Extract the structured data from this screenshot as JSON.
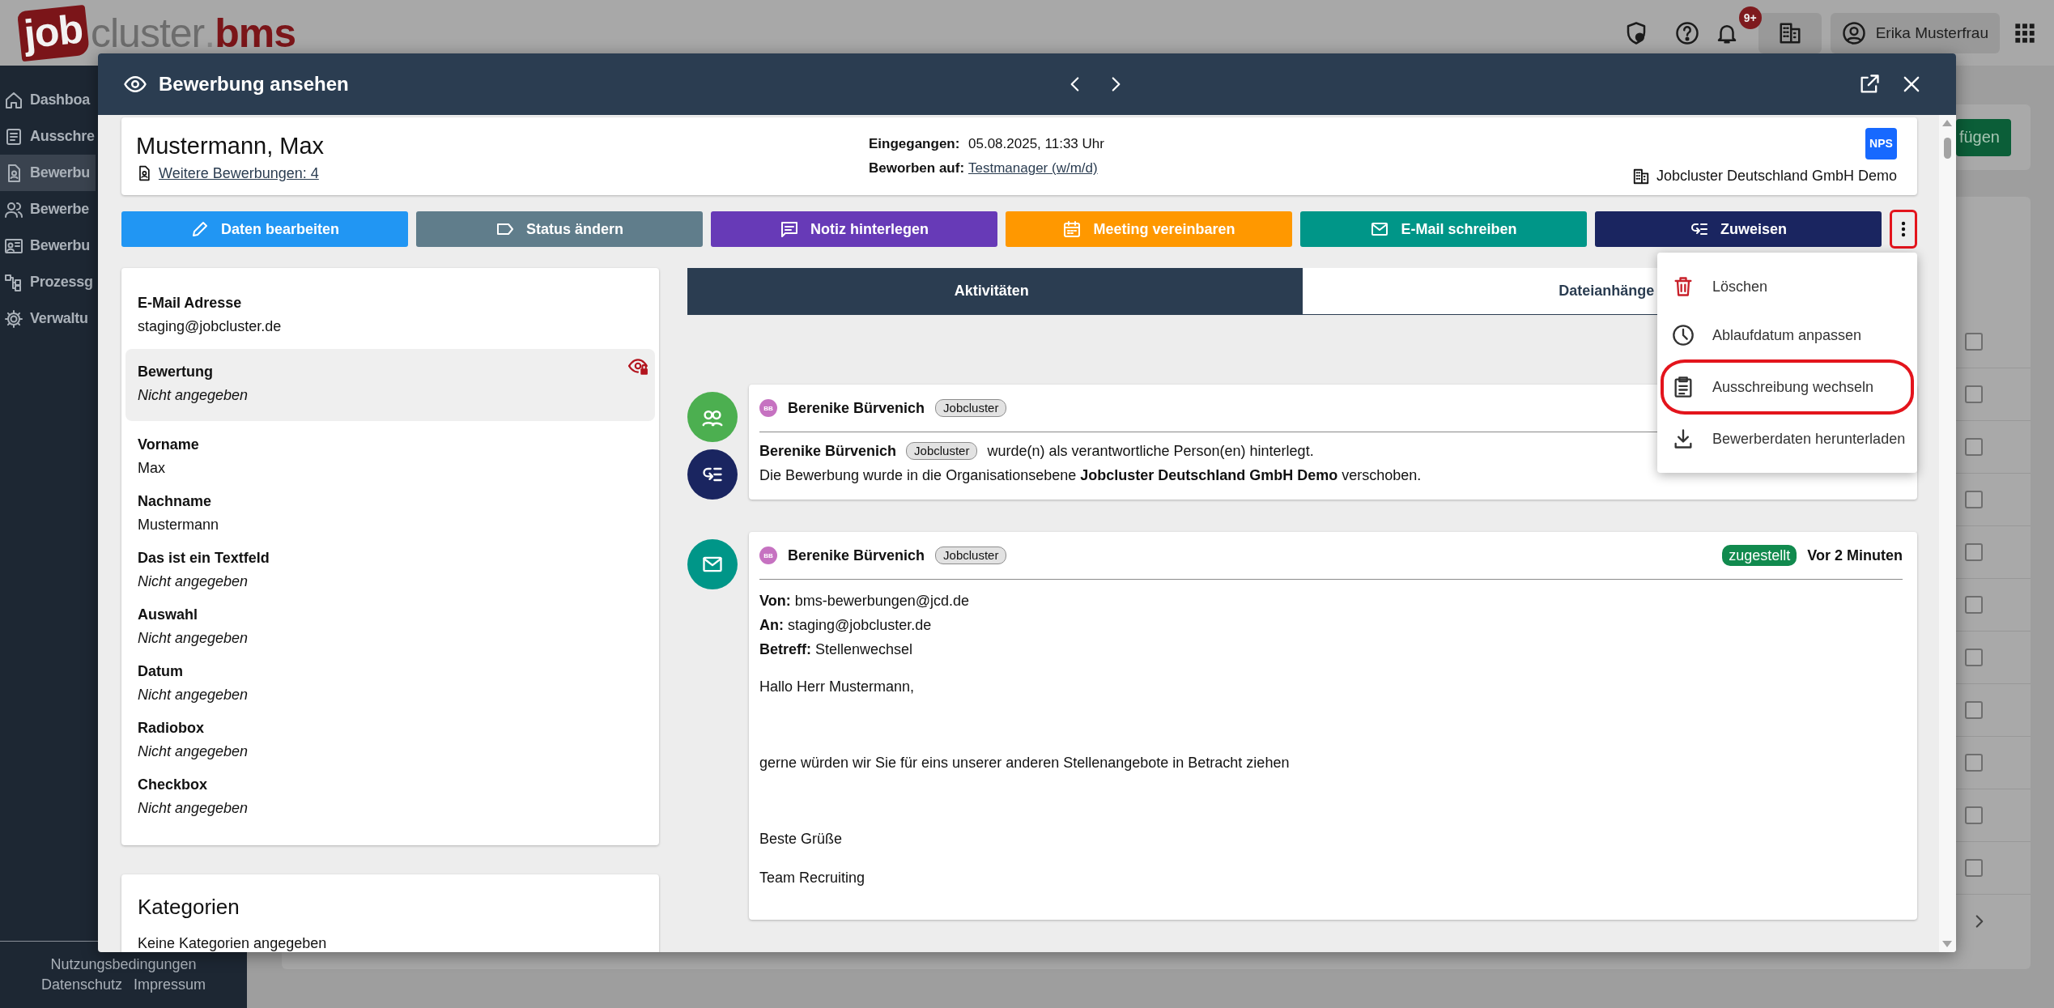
{
  "app": {
    "logo": [
      "job",
      "cluster",
      ".",
      "bms"
    ],
    "topbar": {
      "notifications": "9+",
      "user": "Erika Musterfrau"
    },
    "sidebar": {
      "items": [
        {
          "label": "Dashboa",
          "selected": false
        },
        {
          "label": "Ausschre",
          "selected": false
        },
        {
          "label": "Bewerbu",
          "selected": true
        },
        {
          "label": "Bewerbe",
          "selected": false
        },
        {
          "label": "Bewerbu",
          "selected": false
        },
        {
          "label": "Prozessg",
          "selected": false
        },
        {
          "label": "Verwaltu",
          "selected": false
        }
      ],
      "footer": [
        "Nutzungsbedingungen",
        "Datenschutz",
        "Impressum"
      ]
    },
    "main": {
      "add_button": "fügen",
      "rows": [
        {
          "checked": false
        },
        {
          "checked": false
        },
        {
          "checked": false
        },
        {
          "checked": false
        },
        {
          "checked": false
        },
        {
          "checked": false
        },
        {
          "checked": false
        },
        {
          "checked": false
        },
        {
          "checked": false
        },
        {
          "checked": false
        },
        {
          "checked": false
        }
      ]
    }
  },
  "modal": {
    "title": "Bewerbung ansehen",
    "applicant": {
      "name": "Mustermann, Max",
      "other_applications": "Weitere Bewerbungen: 4",
      "meta": [
        {
          "label": "Eingegangen:",
          "value": "05.08.2025, 11:33 Uhr",
          "link": false
        },
        {
          "label": "Beworben auf:",
          "value": "Testmanager (w/m/d)",
          "link": true
        }
      ],
      "badge": "NPS",
      "organisation": "Jobcluster Deutschland GmbH Demo"
    },
    "actions": [
      {
        "label": "Daten bearbeiten",
        "color": "#2196f3"
      },
      {
        "label": "Status ändern",
        "color": "#607d8b"
      },
      {
        "label": "Notiz hinterlegen",
        "color": "#673ab7"
      },
      {
        "label": "Meeting vereinbaren",
        "color": "#ff9800"
      },
      {
        "label": "E-Mail schreiben",
        "color": "#009688"
      },
      {
        "label": "Zuweisen",
        "color": "#1a2560"
      }
    ],
    "more_button": {
      "highlighted": true
    },
    "fields": [
      {
        "label": "E-Mail Adresse",
        "value": "staging@jobcluster.de",
        "missing": false,
        "restricted": false
      },
      {
        "label": "Bewertung",
        "value": "Nicht angegeben",
        "missing": true,
        "restricted": true
      },
      {
        "label": "Vorname",
        "value": "Max",
        "missing": false,
        "restricted": false
      },
      {
        "label": "Nachname",
        "value": "Mustermann",
        "missing": false,
        "restricted": false
      },
      {
        "label": "Das ist ein Textfeld",
        "value": "Nicht angegeben",
        "missing": true,
        "restricted": false
      },
      {
        "label": "Auswahl",
        "value": "Nicht angegeben",
        "missing": true,
        "restricted": false
      },
      {
        "label": "Datum",
        "value": "Nicht angegeben",
        "missing": true,
        "restricted": false
      },
      {
        "label": "Radiobox",
        "value": "Nicht angegeben",
        "missing": true,
        "restricted": false
      },
      {
        "label": "Checkbox",
        "value": "Nicht angegeben",
        "missing": true,
        "restricted": false
      }
    ],
    "categories": {
      "title": "Kategorien",
      "text": "Keine Kategorien angegeben"
    },
    "tabs": [
      {
        "label": "Aktivitäten",
        "selected": true
      },
      {
        "label": "Dateianhänge",
        "selected": false
      }
    ],
    "activities": [
      {
        "kind": "assignment",
        "author": {
          "initials": "BB",
          "name": "Berenike Bürvenich",
          "tag": "Jobcluster"
        },
        "lines": [
          {
            "name": "Berenike Bürvenich",
            "tag": "Jobcluster",
            "text": "wurde(n) als verantwortliche Person(en) hinterlegt."
          },
          {
            "text": "Die Bewerbung wurde in die Organisationsebene **Jobcluster Deutschland GmbH Demo** verschoben."
          }
        ]
      },
      {
        "kind": "email",
        "author": {
          "initials": "BB",
          "name": "Berenike Bürvenich",
          "tag": "Jobcluster"
        },
        "status": "zugestellt",
        "time": "Vor 2 Minuten",
        "headers": [
          "**Von:** bms-bewerbungen@jcd.de",
          "**An:** staging@jobcluster.de",
          "**Betreff:** Stellenwechsel"
        ],
        "paragraphs": [
          "Hallo Herr Mustermann,",
          "gerne würden wir Sie für eins unserer anderen Stellenangebote in Betracht ziehen",
          "Beste Grüße",
          "Team Recruiting"
        ]
      }
    ],
    "menu": [
      {
        "label": "Löschen",
        "kind": "delete",
        "highlighted": false
      },
      {
        "label": "Ablaufdatum anpassen",
        "kind": "expiry",
        "highlighted": false
      },
      {
        "label": "Ausschreibung wechseln",
        "kind": "switch",
        "highlighted": true
      },
      {
        "label": "Bewerberdaten herunterladen",
        "kind": "download",
        "highlighted": false
      }
    ]
  }
}
